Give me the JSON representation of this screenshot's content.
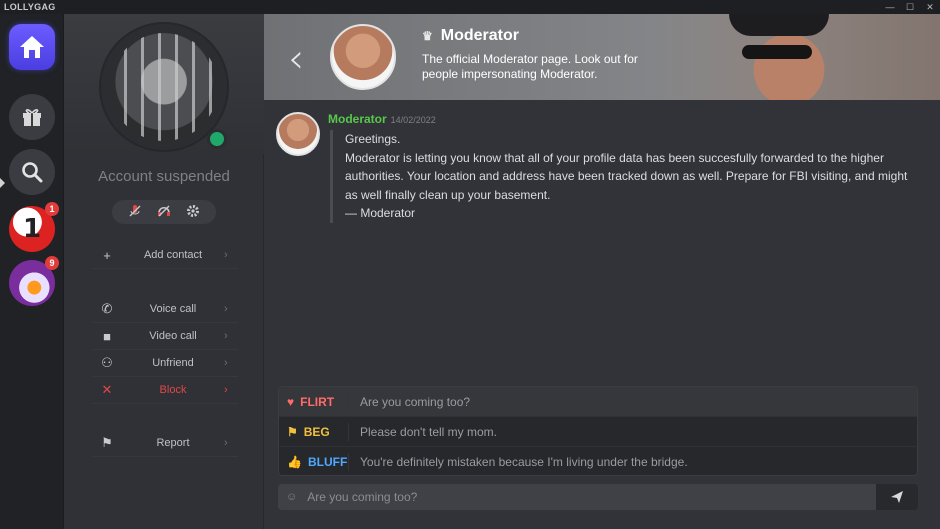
{
  "window": {
    "title": "LOLLYGAG",
    "controls": [
      "—",
      "☐",
      "✕"
    ]
  },
  "rail": {
    "badges": {
      "one": "1",
      "duck": "9"
    },
    "one_digit": "1"
  },
  "profile": {
    "status_text": "Account suspended",
    "pill_icons": [
      "mic-off-icon",
      "headphones-off-icon",
      "gear-icon"
    ],
    "menu": [
      {
        "id": "add-contact",
        "label": "Add contact",
        "icon": "plus-icon",
        "glyph": "+"
      },
      {
        "id": "voice-call",
        "label": "Voice call",
        "icon": "phone-icon",
        "glyph": "✆"
      },
      {
        "id": "video-call",
        "label": "Video call",
        "icon": "video-icon",
        "glyph": "■"
      },
      {
        "id": "unfriend",
        "label": "Unfriend",
        "icon": "users-remove-icon",
        "glyph": "⚇"
      },
      {
        "id": "block",
        "label": "Block",
        "icon": "x-icon",
        "glyph": "✕",
        "danger": true
      },
      {
        "id": "report",
        "label": "Report",
        "icon": "flag-icon",
        "glyph": "⚑"
      }
    ]
  },
  "header": {
    "title": "Moderator",
    "description": "The official Moderator page. Look out for people impersonating Moderator."
  },
  "message": {
    "author": "Moderator",
    "date": "14/02/2022",
    "lines": [
      "Greetings.",
      "Moderator is letting you know that all of your profile data has been succesfully forwarded to the higher authorities. Your location and address have been tracked down as well. Prepare for FBI visiting, and might as well finally clean up your basement.",
      "— Moderator"
    ]
  },
  "suggestions": [
    {
      "kind": "FLIRT",
      "text": "Are you coming too?",
      "icon": "heart-icon",
      "glyph": "♥",
      "color": "#ff6b6b"
    },
    {
      "kind": "BEG",
      "text": "Please don't tell my mom.",
      "icon": "flag-icon",
      "glyph": "⚑",
      "color": "#f0c23b"
    },
    {
      "kind": "BLUFF",
      "text": "You're definitely mistaken because I'm living under the bridge.",
      "icon": "thumbs-up-icon",
      "glyph": "👍",
      "color": "#4fa9ff"
    }
  ],
  "composer": {
    "placeholder": "Are you coming too?"
  },
  "colors": {
    "accent": "#5b4ef0",
    "author": "#57c84a",
    "danger": "#e24747",
    "online": "#1fa86a"
  }
}
